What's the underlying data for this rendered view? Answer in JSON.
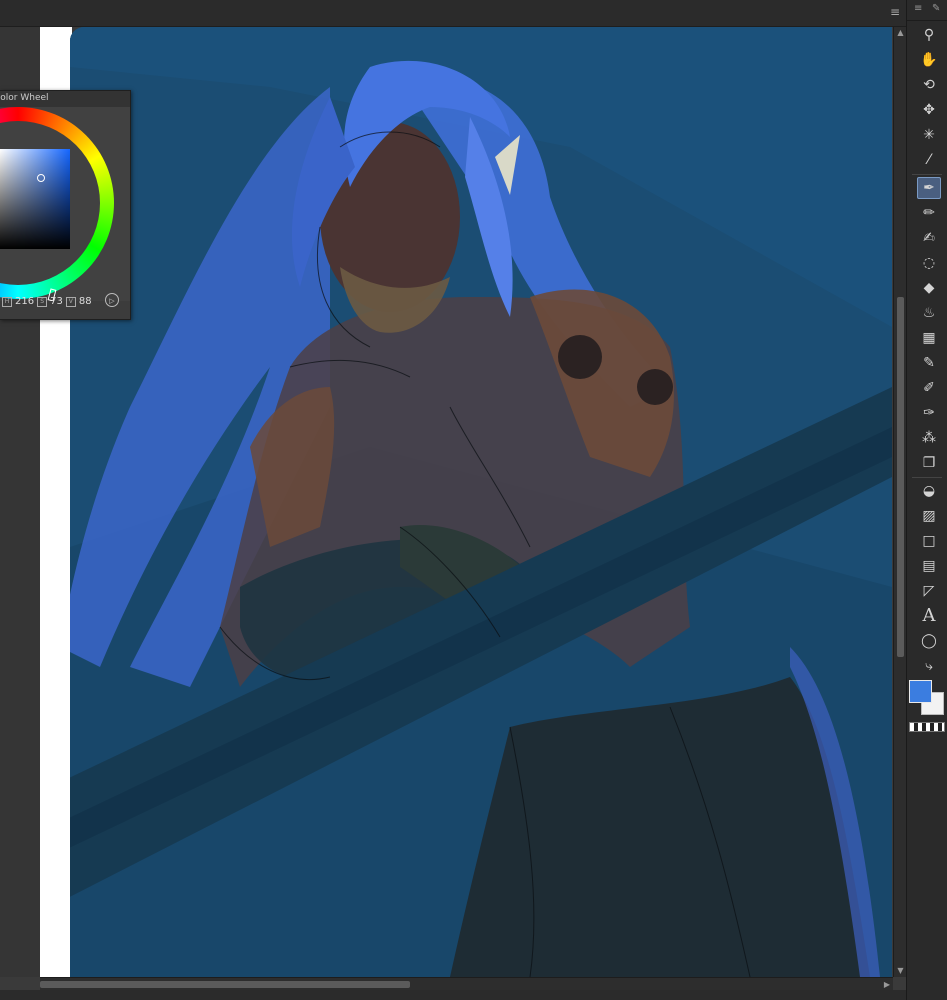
{
  "window": {
    "menu_icon": "hamburger-icon"
  },
  "color_wheel": {
    "title": "Color Wheel",
    "values": {
      "h": "216",
      "s": "73",
      "v": "88"
    },
    "selected_color": "#3f7fe0"
  },
  "canvas": {
    "background_color": "#1b4d73",
    "artwork": "digital-painting"
  },
  "toolbar": {
    "tools": [
      "zoom-icon",
      "hand-icon",
      "rotate-icon",
      "move-icon",
      "magic-wand-icon",
      "eyedropper-icon",
      "pen-icon",
      "pencil-icon",
      "brush-icon",
      "lasso-icon",
      "eraser-icon",
      "blend-icon",
      "mesh-icon",
      "marker-icon",
      "airbrush-icon",
      "decoration-icon",
      "spray-icon",
      "copy-stamp-icon",
      "fill-icon",
      "gradient-icon",
      "rectangle-icon",
      "frame-icon",
      "ruler-icon",
      "text-icon",
      "balloon-icon",
      "correction-line-icon"
    ],
    "active_tool": "pen-icon",
    "text_tool_glyph": "A",
    "foreground_color": "#3b7de0",
    "background_color": "#f2f2f2"
  }
}
